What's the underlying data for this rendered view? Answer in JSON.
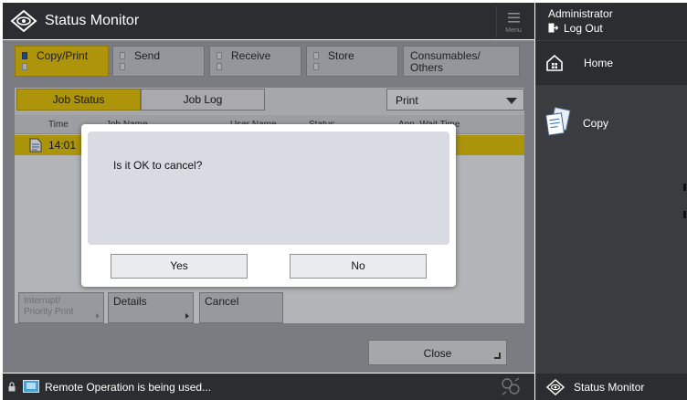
{
  "window": {
    "title": "Status Monitor",
    "menu_label": "Menu"
  },
  "categories": [
    {
      "label": "Copy/Print",
      "active": true
    },
    {
      "label": "Send",
      "active": false
    },
    {
      "label": "Receive",
      "active": false
    },
    {
      "label": "Store",
      "active": false
    },
    {
      "label": "Consumables/\nOthers",
      "active": false
    }
  ],
  "subtabs": {
    "job_status": "Job Status",
    "job_log": "Job Log"
  },
  "filter": {
    "selected": "Print"
  },
  "table": {
    "columns": [
      "Time",
      "Job Name",
      "User Name",
      "Status",
      "App. Wait Time"
    ],
    "rows": [
      {
        "time": "14:01"
      }
    ]
  },
  "actions": {
    "interrupt": "Interrupt/\nPriority Print",
    "details": "Details",
    "cancel": "Cancel",
    "close": "Close"
  },
  "dialog": {
    "message": "Is it OK to cancel?",
    "yes": "Yes",
    "no": "No"
  },
  "statusbar": {
    "message": "Remote Operation is being used..."
  },
  "sidebar": {
    "user": "Administrator",
    "logout": "Log Out",
    "home": "Home",
    "copy": "Copy",
    "status_monitor": "Status Monitor"
  },
  "colors": {
    "accent": "#e5c200",
    "dark": "#2c2d30",
    "panel": "#9fa1a5"
  },
  "icons": [
    "status-monitor-icon",
    "menu-icon",
    "document-icon",
    "lock-icon",
    "remote-icon",
    "network-icon",
    "logout-icon",
    "home-icon",
    "copy-icon"
  ]
}
